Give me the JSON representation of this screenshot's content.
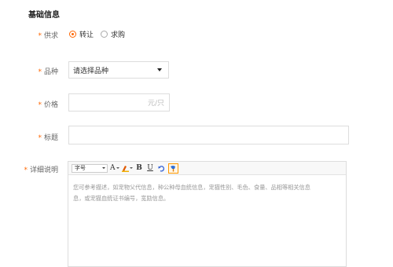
{
  "section": {
    "title": "基础信息"
  },
  "supply": {
    "label": "供求",
    "options": [
      {
        "text": "转让",
        "checked": true
      },
      {
        "text": "求购",
        "checked": false
      }
    ]
  },
  "breed": {
    "label": "品种",
    "selected": "请选择品种"
  },
  "price": {
    "label": "价格",
    "unit": "元/只",
    "value": ""
  },
  "title_field": {
    "label": "标题",
    "value": ""
  },
  "detail": {
    "label": "详细说明",
    "toolbar": {
      "font_size": "字号",
      "font_color": "A",
      "bold": "B",
      "underline": "U"
    },
    "hint_line1": "您可参考描述，如宠物父代信息，种公种母血统信息，宠猫性别、毛色、食量、品相等相关信息",
    "hint_line2": "息，或宠猫血统证书编号，宽励信息。"
  },
  "colors": {
    "required": "#ff6600",
    "accent": "#ff6600",
    "border": "#dddddd"
  }
}
